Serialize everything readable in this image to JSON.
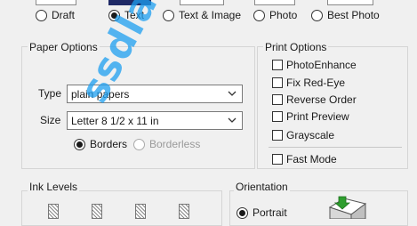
{
  "print_quality": {
    "options": [
      {
        "label": "Draft",
        "checked": false
      },
      {
        "label": "Text",
        "checked": true
      },
      {
        "label": "Text & Image",
        "checked": false
      },
      {
        "label": "Photo",
        "checked": false
      },
      {
        "label": "Best Photo",
        "checked": false
      }
    ]
  },
  "paper_options": {
    "title": "Paper Options",
    "type_label": "Type",
    "type_value": "plain papers",
    "size_label": "Size",
    "size_value": "Letter 8 1/2 x 11 in",
    "borders_label": "Borders",
    "borderless_label": "Borderless",
    "borders_selected": true
  },
  "print_options": {
    "title": "Print Options",
    "items": [
      {
        "label": "PhotoEnhance",
        "checked": false
      },
      {
        "label": "Fix Red-Eye",
        "checked": false
      },
      {
        "label": "Reverse Order",
        "checked": false
      },
      {
        "label": "Print Preview",
        "checked": false
      },
      {
        "label": "Grayscale",
        "checked": false
      },
      {
        "label": "Fast Mode",
        "checked": false
      }
    ]
  },
  "ink_levels": {
    "title": "Ink Levels"
  },
  "orientation": {
    "title": "Orientation",
    "portrait_label": "Portrait",
    "portrait_selected": true
  },
  "watermark": {
    "text": "ssdland.blogspot.com"
  },
  "colors": {
    "accent": "#1f2a66",
    "watermark": "#1e9ff0",
    "printer_arrow": "#2e9e2e"
  }
}
